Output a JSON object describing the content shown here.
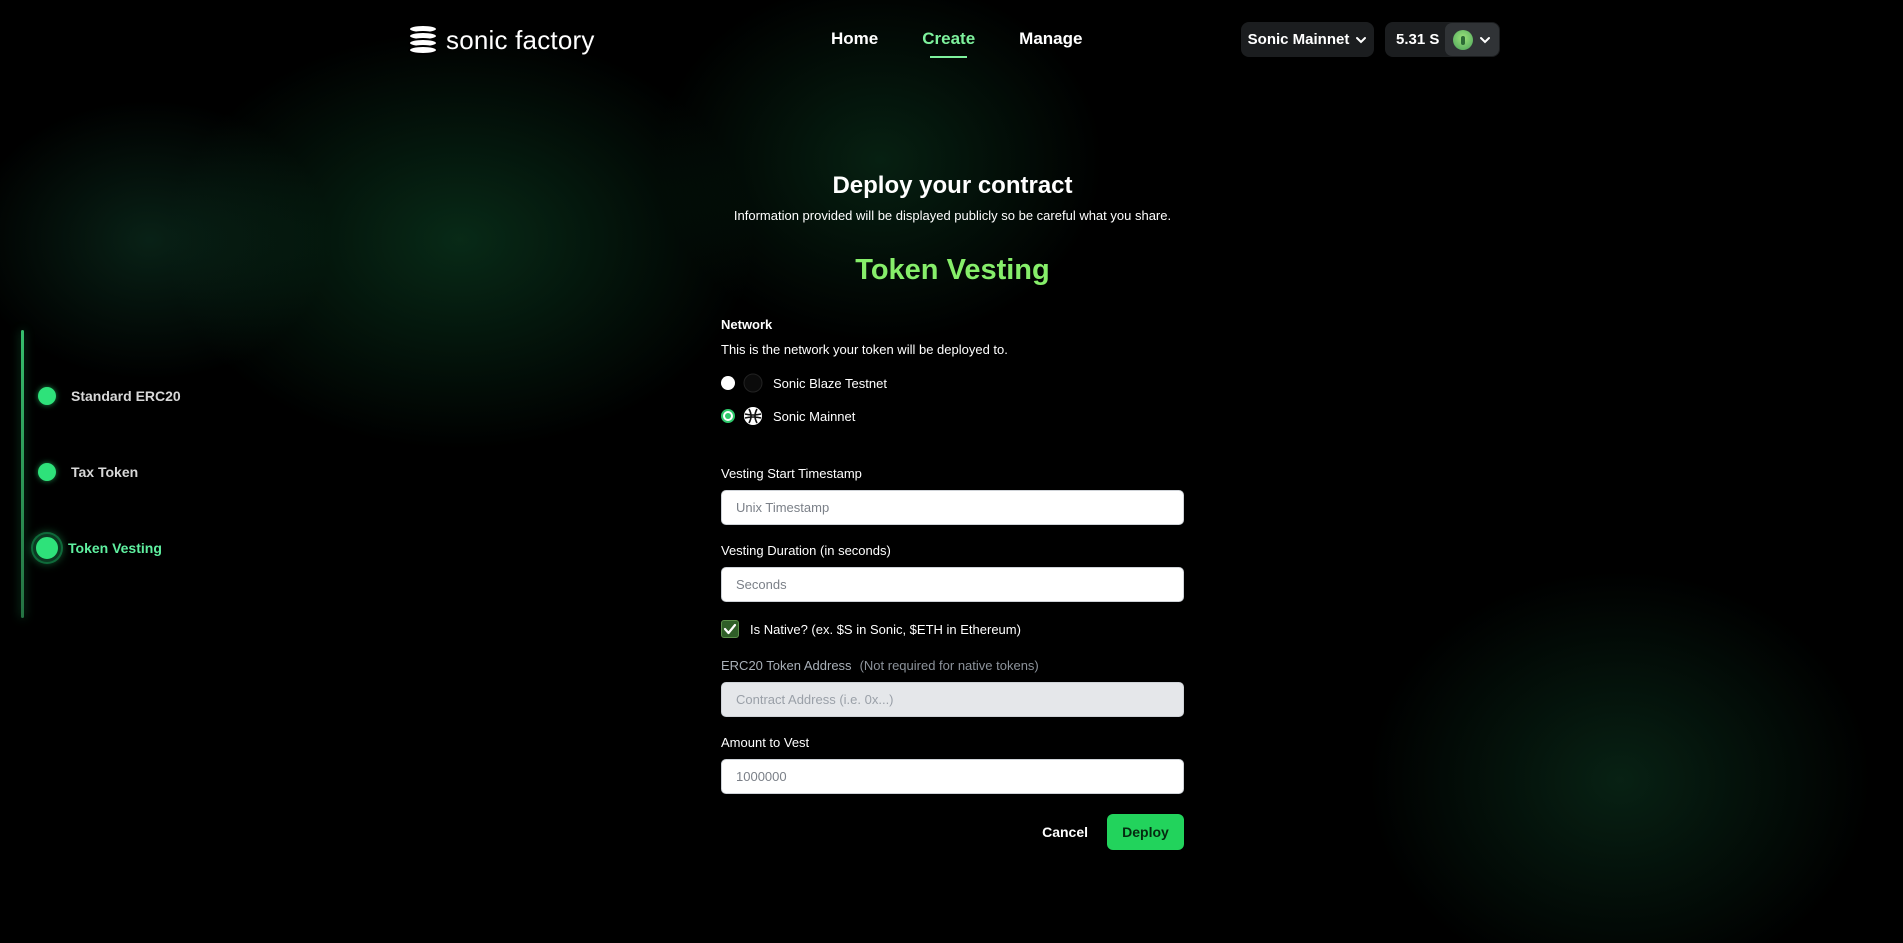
{
  "header": {
    "brand": "sonic factory",
    "nav": [
      {
        "label": "Home"
      },
      {
        "label": "Create"
      },
      {
        "label": "Manage"
      }
    ],
    "network_selector": "Sonic Mainnet",
    "balance": "5.31 S"
  },
  "sidebar": {
    "steps": [
      {
        "label": "Standard ERC20"
      },
      {
        "label": "Tax Token"
      },
      {
        "label": "Token Vesting"
      }
    ]
  },
  "main": {
    "title": "Deploy your contract",
    "subtitle": "Information provided will be displayed publicly so be careful what you share.",
    "section_title": "Token Vesting",
    "network": {
      "label": "Network",
      "hint": "This is the network your token will be deployed to.",
      "options": [
        {
          "label": "Sonic Blaze Testnet",
          "selected": false
        },
        {
          "label": "Sonic Mainnet",
          "selected": true
        }
      ]
    },
    "vesting_start": {
      "label": "Vesting Start Timestamp",
      "placeholder": "Unix Timestamp"
    },
    "vesting_duration": {
      "label": "Vesting Duration (in seconds)",
      "placeholder": "Seconds"
    },
    "is_native": {
      "label": "Is Native? (ex. $S in Sonic, $ETH in Ethereum)",
      "checked": true
    },
    "erc20_address": {
      "label": "ERC20 Token Address",
      "note": "(Not required for native tokens)",
      "placeholder": "Contract Address (i.e. 0x...)"
    },
    "amount": {
      "label": "Amount to Vest",
      "placeholder": "1000000"
    },
    "cancel_label": "Cancel",
    "deploy_label": "Deploy"
  },
  "colors": {
    "accent": "#22d35c",
    "section_title": "#86ee6a",
    "nav_active": "#7ef29d"
  }
}
